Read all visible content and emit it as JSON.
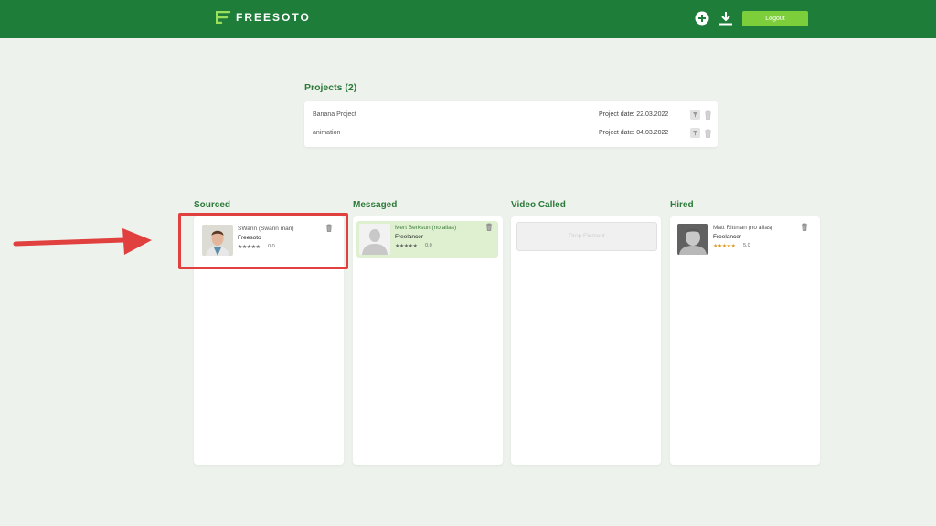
{
  "header": {
    "brand": "FREESOTO",
    "logout_label": "Logout",
    "icons": [
      "add-circle-icon",
      "download-icon"
    ],
    "colors": {
      "bar": "#1f7d3a",
      "accent": "#7ccf3a"
    }
  },
  "projects": {
    "title": "Projects (2)",
    "items": [
      {
        "name": "Banana Project",
        "date": "Project date: 22.03.2022"
      },
      {
        "name": "animation",
        "date": "Project date: 04.03.2022"
      }
    ]
  },
  "columns": [
    {
      "title": "Sourced"
    },
    {
      "title": "Messaged"
    },
    {
      "title": "Video Called"
    },
    {
      "title": "Hired"
    }
  ],
  "candidates": {
    "sourced": {
      "name": "SWann (Swann man)",
      "org": "Freesoto",
      "stars": "★★★★★",
      "rating": "0.0"
    },
    "messaged": {
      "name": "Mert Berksun (no alias)",
      "org": "Freelancer",
      "stars": "★★★★★",
      "rating": "0.0"
    },
    "hired": {
      "name": "Matt Rittman (no alias)",
      "org": "Freelancer",
      "stars": "★★★★★",
      "rating": "5.0"
    }
  },
  "video_called": {
    "drop_label": "Drop Element"
  },
  "annotation": {
    "color": "#e0403e"
  }
}
